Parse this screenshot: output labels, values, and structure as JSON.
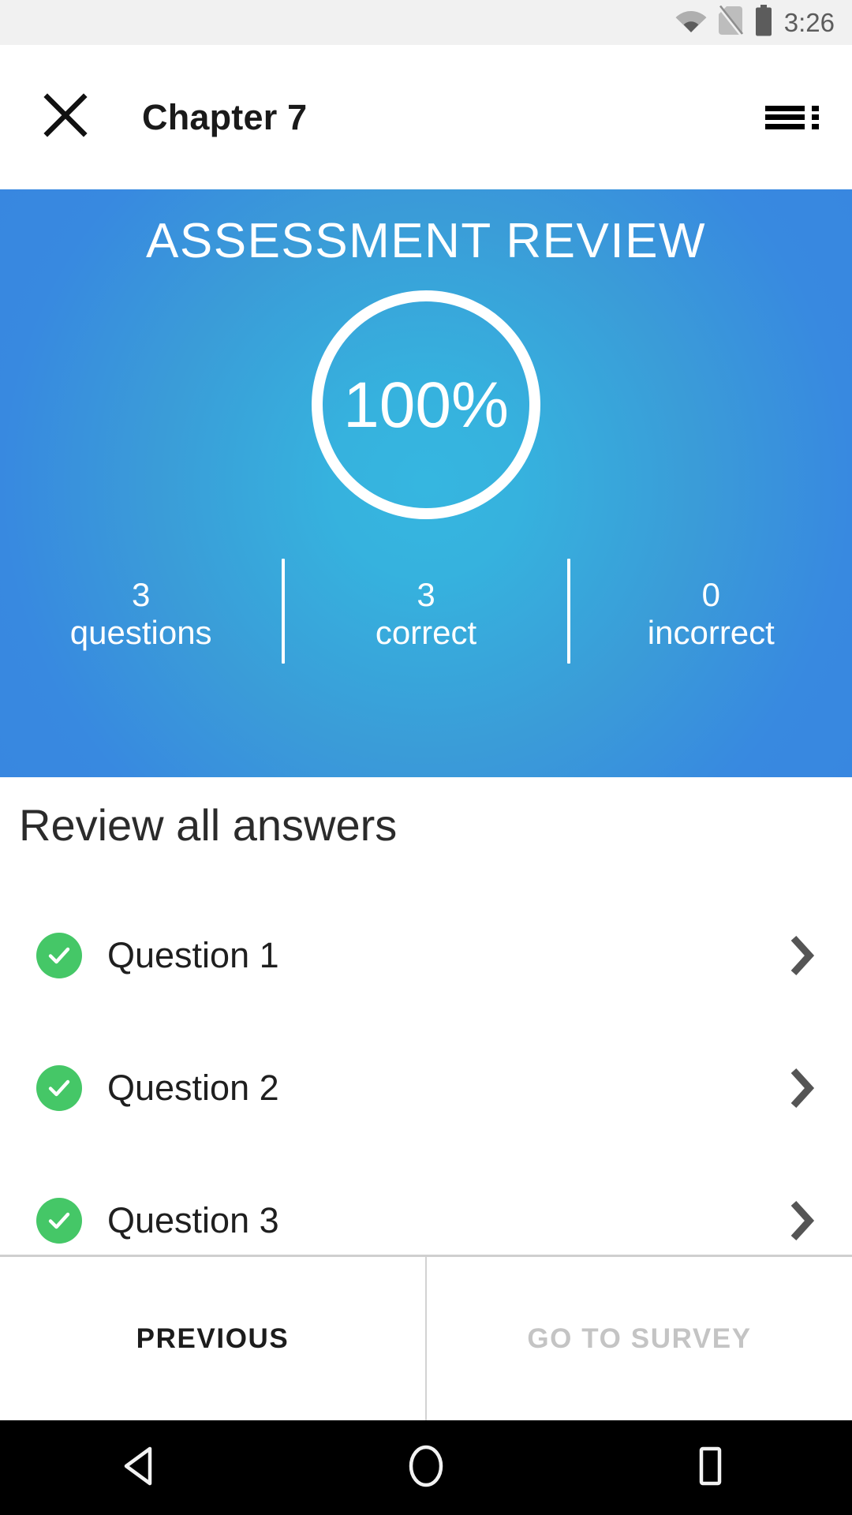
{
  "status_bar": {
    "time": "3:26",
    "icons": [
      {
        "name": "wifi-icon",
        "label": "wifi"
      },
      {
        "name": "no-sim-icon",
        "label": "no-sim"
      },
      {
        "name": "battery-full-icon",
        "label": "battery-full"
      }
    ],
    "background": "#F1F1F1",
    "icon_color": "#5C5C5C"
  },
  "app_bar": {
    "close_icon": "close-icon",
    "title": "Chapter 7",
    "overflow_icon": "list-menu-icon"
  },
  "hero": {
    "title": "ASSESSMENT REVIEW",
    "score": "100%",
    "gradient_center": "#36B6E0",
    "gradient_edge": "#3887E0",
    "stats": [
      {
        "number": "3",
        "label": "questions"
      },
      {
        "number": "3",
        "label": "correct"
      },
      {
        "number": "0",
        "label": "incorrect"
      }
    ]
  },
  "review": {
    "heading": "Review all answers",
    "questions": [
      {
        "label": "Question 1",
        "status": "correct",
        "status_icon": "check-circle-icon",
        "chevron": "chevron-right-icon"
      },
      {
        "label": "Question 2",
        "status": "correct",
        "status_icon": "check-circle-icon",
        "chevron": "chevron-right-icon"
      },
      {
        "label": "Question 3",
        "status": "correct",
        "status_icon": "check-circle-icon",
        "chevron": "chevron-right-icon"
      }
    ],
    "correct_color": "#45C767"
  },
  "bottom_bar": {
    "previous_label": "PREVIOUS",
    "survey_label": "GO TO SURVEY",
    "previous_enabled": true,
    "survey_enabled": false
  },
  "nav_bar": {
    "back": "back-triangle-icon",
    "home": "home-circle-icon",
    "recents": "recents-square-icon"
  }
}
